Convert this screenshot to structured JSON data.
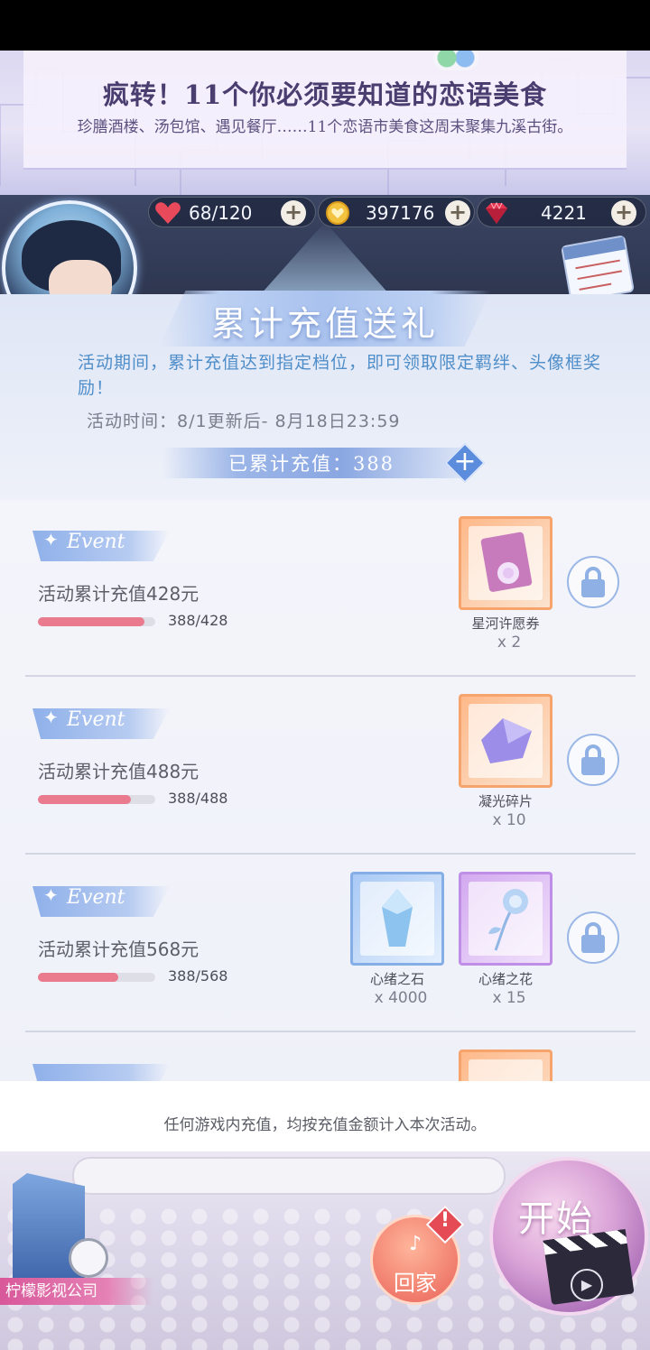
{
  "banner": {
    "title": "疯转！11个你必须要知道的恋语美食",
    "subtitle": "珍膳酒楼、汤包馆、遇见餐厅……11个恋语市美食这周末聚集九溪古街。"
  },
  "resources": {
    "stamina": "68/120",
    "gold": "397176",
    "diamond": "4221",
    "plus": "+"
  },
  "event": {
    "title": "累计充值送礼",
    "description": "活动期间，累计充值达到指定档位，即可领取限定羁绊、头像框奖励！",
    "period": "活动时间：8/1更新后- 8月18日23:59",
    "total_label": "已累计充值：388",
    "total_plus": "+"
  },
  "tiers": [
    {
      "tag": "Event",
      "label": "活动累计充值428元",
      "progress_text": "388/428",
      "progress": 0.907,
      "rewards": [
        {
          "name": "星河许愿券",
          "qty": "x 2",
          "icon": "wish-ticket-icon",
          "frame": "orange"
        }
      ]
    },
    {
      "tag": "Event",
      "label": "活动累计充值488元",
      "progress_text": "388/488",
      "progress": 0.795,
      "rewards": [
        {
          "name": "凝光碎片",
          "qty": "x 10",
          "icon": "crystal-shard-icon",
          "frame": "orange"
        }
      ]
    },
    {
      "tag": "Event",
      "label": "活动累计充值568元",
      "progress_text": "388/568",
      "progress": 0.683,
      "rewards": [
        {
          "name": "心绪之石",
          "qty": "x 4000",
          "icon": "blue-crystal-icon",
          "frame": "blue"
        },
        {
          "name": "心绪之花",
          "qty": "x 15",
          "icon": "crystal-rose-icon",
          "frame": "purple"
        }
      ]
    }
  ],
  "footer_note": "任何游戏内充值，均按充值金额计入本次活动。",
  "bottom": {
    "company": "柠檬影视公司",
    "home": "回家",
    "start": "开始",
    "alert": "!"
  },
  "colors": {
    "progress_fill": "#ea7b8e",
    "accent_blue": "#4f8ec9",
    "frame_orange": "#f7a36c",
    "frame_blue": "#85aee6",
    "frame_purple": "#bf8ee6"
  }
}
